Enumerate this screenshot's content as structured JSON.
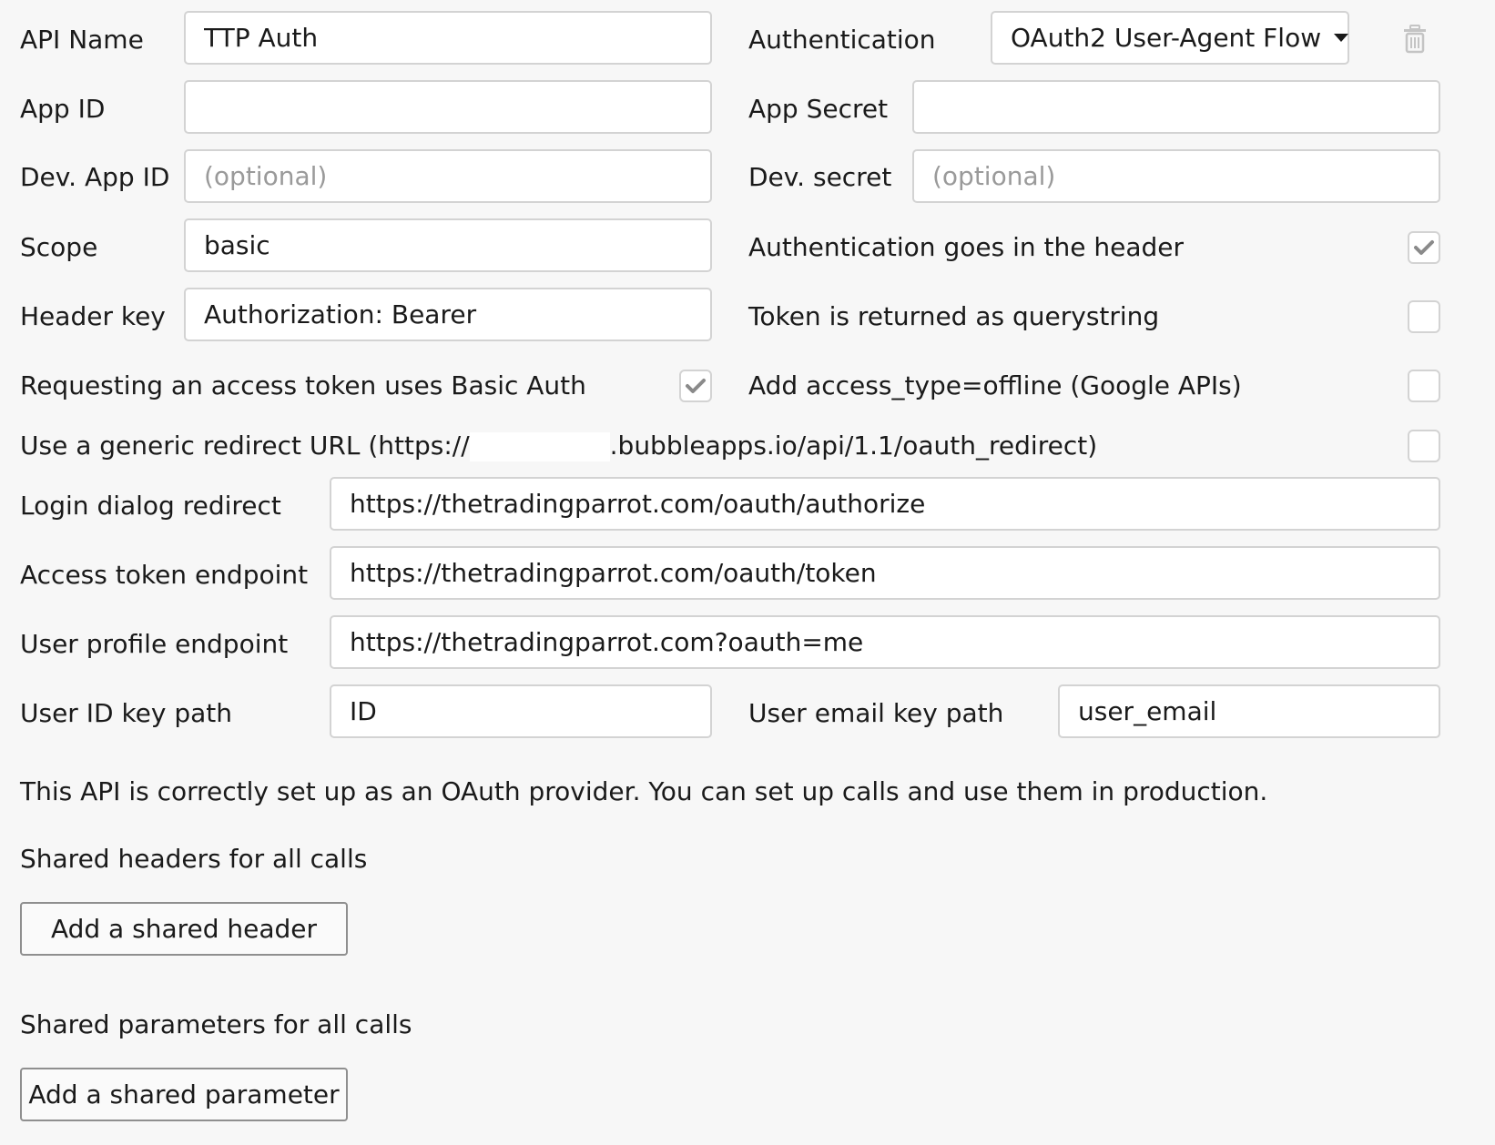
{
  "api_name": {
    "label": "API Name",
    "value": "TTP Auth"
  },
  "authentication": {
    "label": "Authentication",
    "selected": "OAuth2 User-Agent Flow"
  },
  "delete_icon": "trash-icon",
  "app_id": {
    "label": "App ID",
    "value": ""
  },
  "app_secret": {
    "label": "App Secret",
    "value": ""
  },
  "dev_app_id": {
    "label": "Dev. App ID",
    "placeholder": "(optional)"
  },
  "dev_secret": {
    "label": "Dev. secret",
    "placeholder": "(optional)"
  },
  "scope": {
    "label": "Scope",
    "value": "basic"
  },
  "auth_in_header": {
    "label": "Authentication goes in the header",
    "checked": true
  },
  "header_key": {
    "label": "Header key",
    "value": "Authorization: Bearer"
  },
  "token_querystring": {
    "label": "Token is returned as querystring",
    "checked": false
  },
  "basic_auth": {
    "label": "Requesting an access token uses Basic Auth",
    "checked": true
  },
  "access_type_offline": {
    "label": "Add access_type=offline (Google APIs)",
    "checked": false
  },
  "generic_redirect": {
    "label_prefix": "Use a generic redirect URL (https://",
    "label_suffix": ".bubbleapps.io/api/1.1/oauth_redirect)",
    "checked": false
  },
  "login_dialog_redirect": {
    "label": "Login dialog redirect",
    "value": "https://thetradingparrot.com/oauth/authorize"
  },
  "access_token_endpoint": {
    "label": "Access token endpoint",
    "value": "https://thetradingparrot.com/oauth/token"
  },
  "user_profile_endpoint": {
    "label": "User profile endpoint",
    "value": "https://thetradingparrot.com?oauth=me"
  },
  "user_id_key_path": {
    "label": "User ID key path",
    "value": "ID"
  },
  "user_email_key_path": {
    "label": "User email key path",
    "value": "user_email"
  },
  "status_message": "This API is correctly set up as an OAuth provider. You can set up calls and use them in production.",
  "shared_headers": {
    "title": "Shared headers for all calls",
    "button": "Add a shared header"
  },
  "shared_params": {
    "title": "Shared parameters for all calls",
    "button": "Add a shared parameter"
  },
  "colors": {
    "background": "#f7f7f7",
    "field_border": "#d3d3d3",
    "check": "#8a8a8a",
    "placeholder": "#9a9a9a"
  }
}
